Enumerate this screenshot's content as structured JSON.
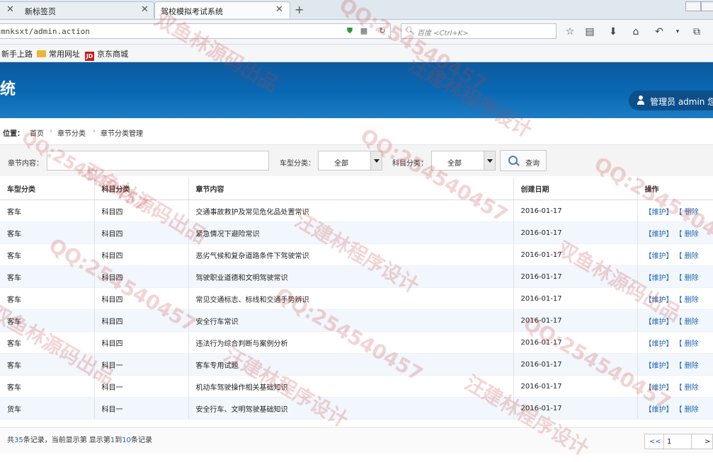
{
  "browser": {
    "tabs": [
      {
        "label": "新标签页"
      },
      {
        "label": "驾校模拟考试系统"
      }
    ],
    "url": "mnksxt/admin.action",
    "search_placeholder": "百度 <Ctrl+K>",
    "bookmarks": [
      "新手上路",
      "常用网址",
      "京东商城"
    ],
    "jd_icon_text": "JD"
  },
  "header": {
    "title_fragment": "统",
    "admin_label": "管理员 admin 您"
  },
  "breadcrumb": {
    "label": "位置：",
    "items": [
      "首页",
      "章节分类",
      "章节分类管理"
    ]
  },
  "filter": {
    "content_label": "章节内容：",
    "content_value": "",
    "car_type_label": "车型分类：",
    "car_type_value": "全部",
    "subject_label": "科目分类：",
    "subject_value": "全部",
    "query_label": "查询"
  },
  "table": {
    "columns": [
      "车型分类",
      "科目分类",
      "章节内容",
      "创建日期",
      "操作"
    ],
    "rows": [
      {
        "car": "客车",
        "subject": "科目四",
        "content": "交通事故救护及常见危化品处置常识",
        "date": "2016-01-17"
      },
      {
        "car": "客车",
        "subject": "科目四",
        "content": "紧急情况下避险常识",
        "date": "2016-01-17"
      },
      {
        "car": "客车",
        "subject": "科目四",
        "content": "恶劣气候和复杂道路条件下驾驶常识",
        "date": "2016-01-17"
      },
      {
        "car": "客车",
        "subject": "科目四",
        "content": "驾驶职业道德和文明驾驶常识",
        "date": "2016-01-17"
      },
      {
        "car": "客车",
        "subject": "科目四",
        "content": "常见交通标志、标线和交通手势辨识",
        "date": "2016-01-17"
      },
      {
        "car": "客车",
        "subject": "科目四",
        "content": "安全行车常识",
        "date": "2016-01-17"
      },
      {
        "car": "客车",
        "subject": "科目四",
        "content": "违法行为综合判断与案例分析",
        "date": "2016-01-17"
      },
      {
        "car": "客车",
        "subject": "科目一",
        "content": "客车专用试题",
        "date": "2016-01-17"
      },
      {
        "car": "客车",
        "subject": "科目一",
        "content": "机动车驾驶操作相关基础知识",
        "date": "2016-01-17"
      },
      {
        "car": "货车",
        "subject": "科目一",
        "content": "安全行车、文明驾驶基础知识",
        "date": "2016-01-17"
      }
    ],
    "action_edit": "【维护】",
    "action_delete": "【 删除"
  },
  "footer": {
    "prefix": "共",
    "total": "35",
    "middle": "条记录，当前显示第  显示第",
    "from": "1",
    "to_word": "到",
    "to": "10",
    "suffix": "条记录",
    "pager_prev": "<<",
    "pager_page": "1",
    "pager_next": ">"
  },
  "watermarks": [
    "双鱼林源码出品",
    "汪建林程序设计",
    "QQ:254540457"
  ],
  "colors": {
    "header_blue": "#0a69b4",
    "link_blue": "#1f66b3",
    "row_stripe": "#f1f7fc"
  }
}
